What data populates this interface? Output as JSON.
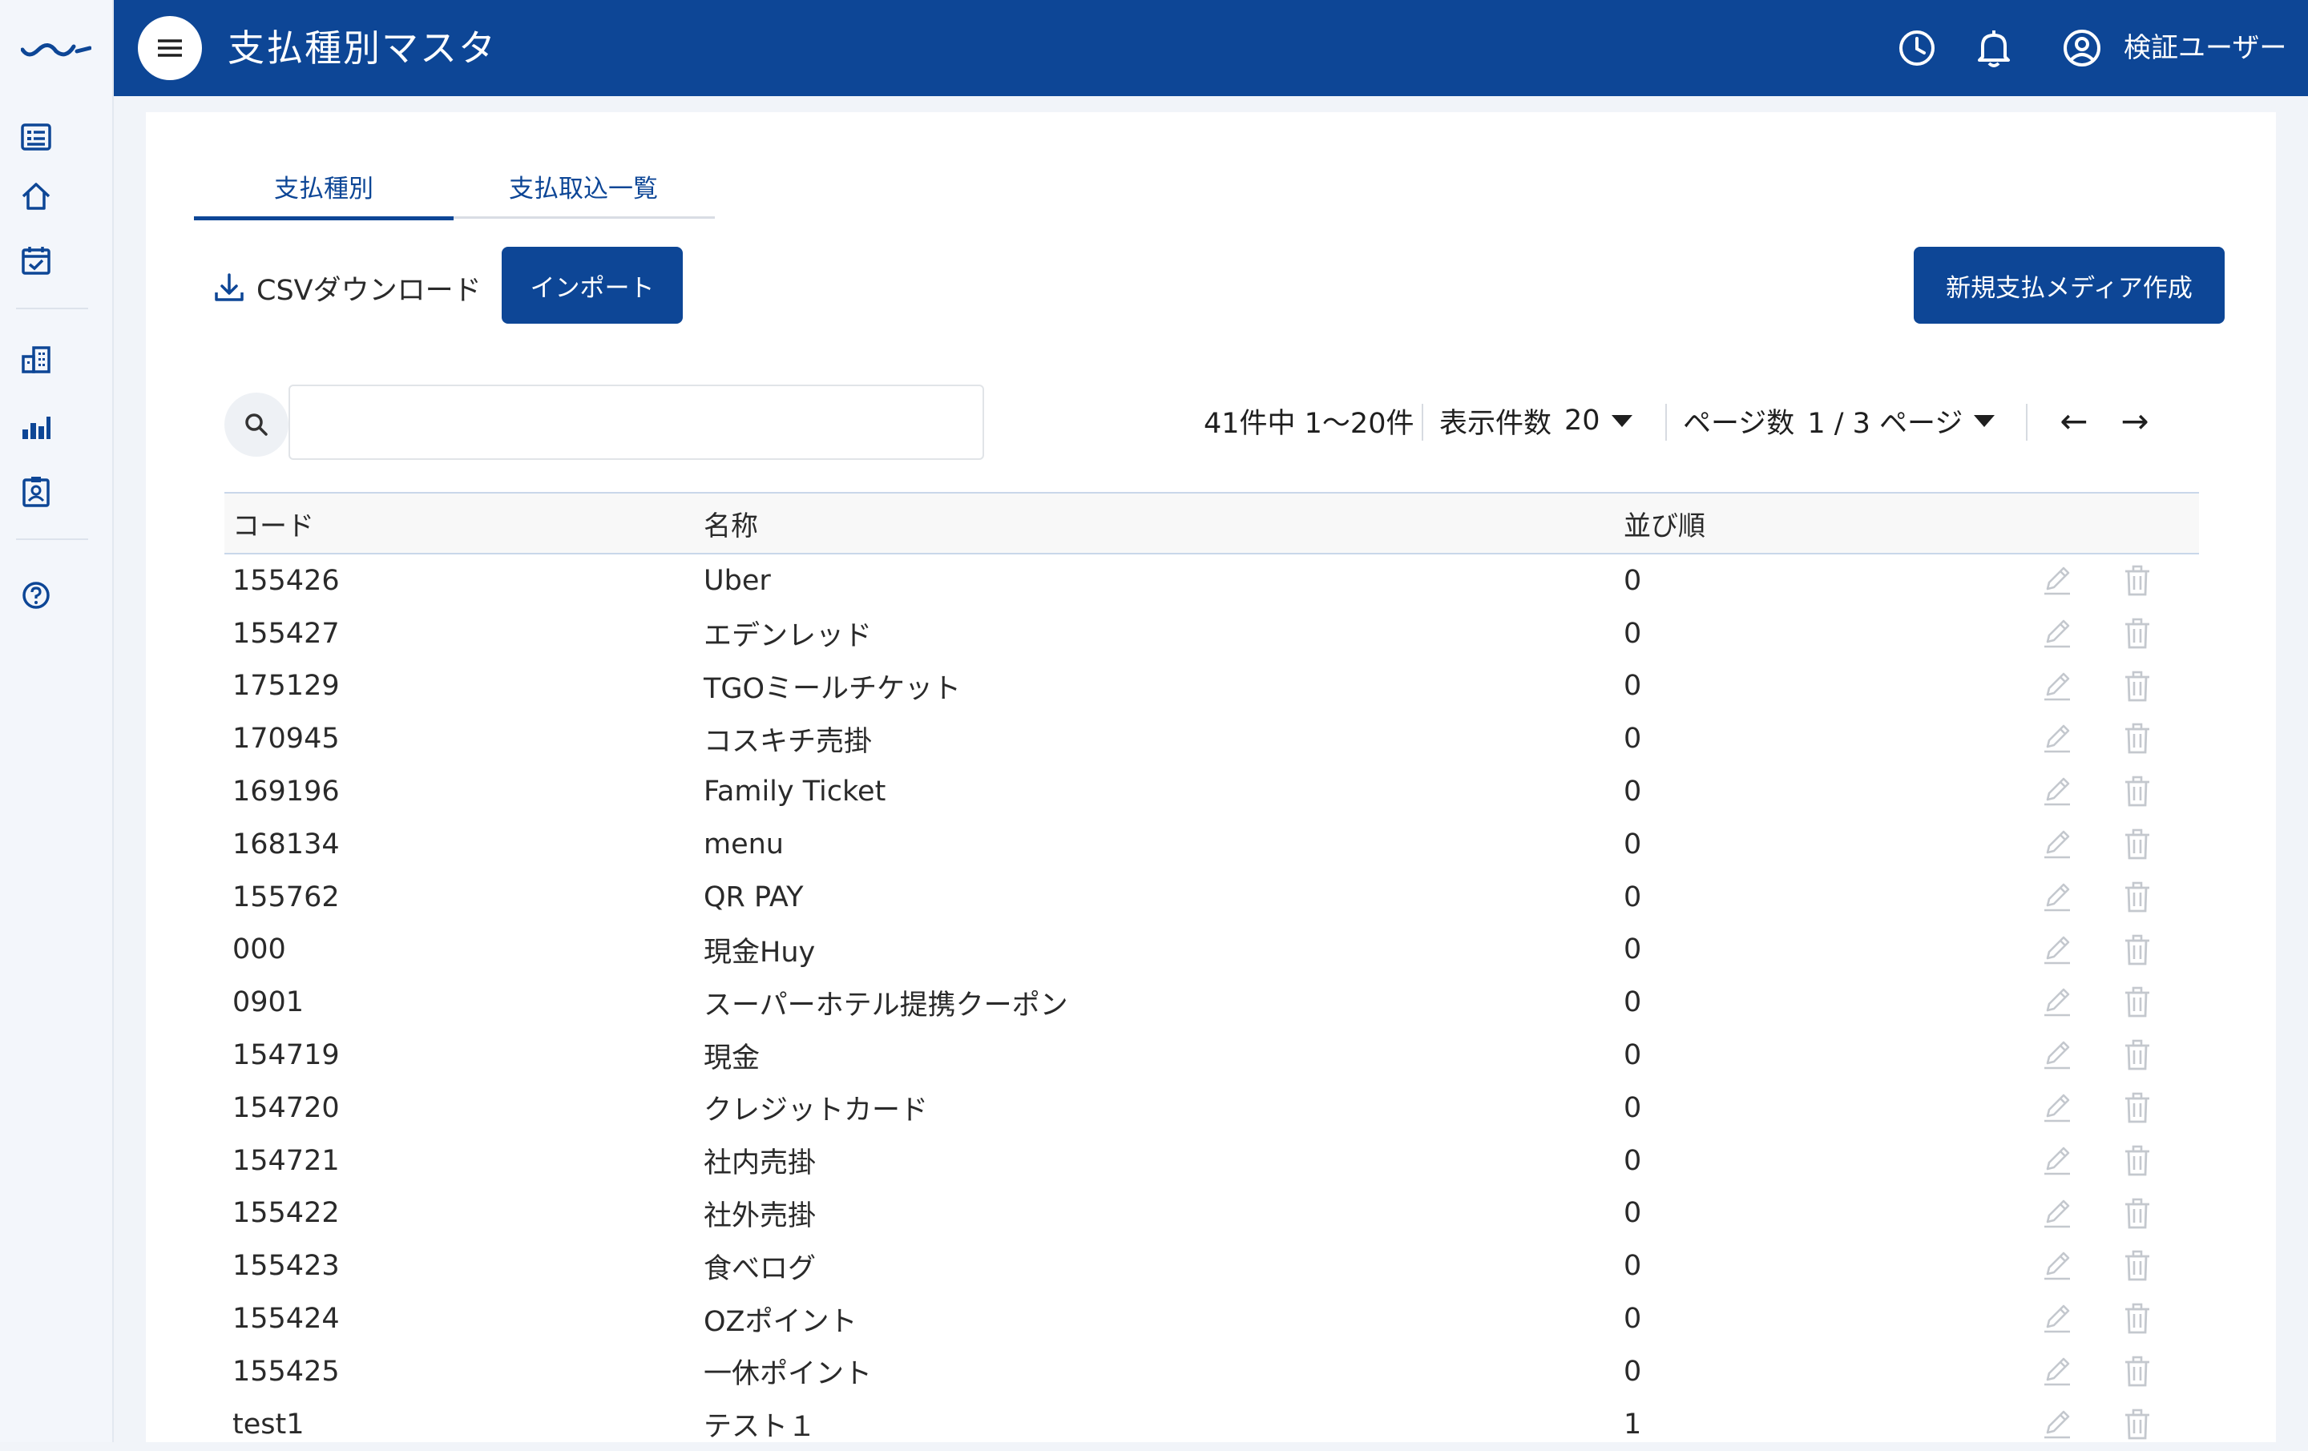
{
  "header": {
    "title": "支払種別マスタ",
    "user_name": "検証ユーザー"
  },
  "colors": {
    "primary": "#0d4696",
    "sidebar_bg": "#f3f6fb",
    "icon_muted": "#bfc3c9"
  },
  "sidebar": {
    "items": [
      {
        "icon": "list-icon"
      },
      {
        "icon": "home-icon"
      },
      {
        "icon": "calendar-check-icon"
      },
      {
        "icon": "building-icon"
      },
      {
        "icon": "bar-chart-icon"
      },
      {
        "icon": "badge-icon"
      },
      {
        "icon": "help-icon"
      }
    ]
  },
  "tabs": [
    {
      "label": "支払種別",
      "active": true
    },
    {
      "label": "支払取込一覧",
      "active": false
    }
  ],
  "toolbar": {
    "csv_label": "CSVダウンロード",
    "import_label": "インポート",
    "create_label": "新規支払メディア作成"
  },
  "search": {
    "value": "",
    "placeholder": ""
  },
  "pagination": {
    "range_text": "41件中 1〜20件",
    "per_page_label": "表示件数",
    "per_page_value": "20",
    "page_label": "ページ数",
    "page_value": "1 / 3 ページ",
    "prev_label": "←",
    "next_label": "→"
  },
  "table": {
    "columns": [
      "コード",
      "名称",
      "並び順"
    ],
    "rows": [
      {
        "code": "155426",
        "name": "Uber",
        "order": "0"
      },
      {
        "code": "155427",
        "name": "エデンレッド",
        "order": "0"
      },
      {
        "code": "175129",
        "name": "TGOミールチケット",
        "order": "0"
      },
      {
        "code": "170945",
        "name": "コスキチ売掛",
        "order": "0"
      },
      {
        "code": "169196",
        "name": "Family Ticket",
        "order": "0"
      },
      {
        "code": "168134",
        "name": "menu",
        "order": "0"
      },
      {
        "code": "155762",
        "name": "QR PAY",
        "order": "0"
      },
      {
        "code": "000",
        "name": "現金Huy",
        "order": "0"
      },
      {
        "code": "0901",
        "name": "スーパーホテル提携クーポン",
        "order": "0"
      },
      {
        "code": "154719",
        "name": "現金",
        "order": "0"
      },
      {
        "code": "154720",
        "name": "クレジットカード",
        "order": "0"
      },
      {
        "code": "154721",
        "name": "社内売掛",
        "order": "0"
      },
      {
        "code": "155422",
        "name": "社外売掛",
        "order": "0"
      },
      {
        "code": "155423",
        "name": "食べログ",
        "order": "0"
      },
      {
        "code": "155424",
        "name": "OZポイント",
        "order": "0"
      },
      {
        "code": "155425",
        "name": "一休ポイント",
        "order": "0"
      },
      {
        "code": "test1",
        "name": "テスト１",
        "order": "1"
      }
    ]
  }
}
